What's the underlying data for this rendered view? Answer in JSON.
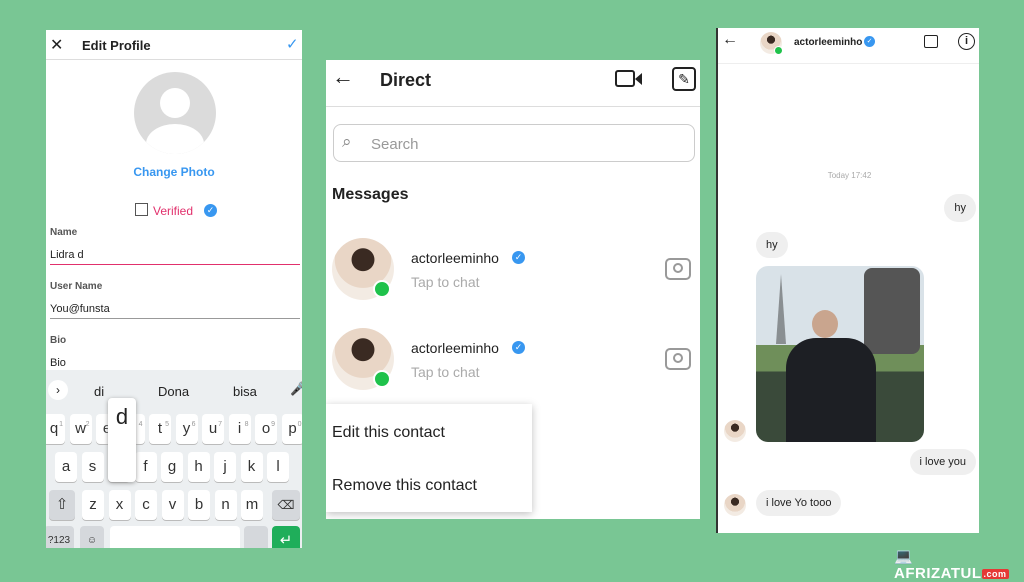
{
  "edit_profile": {
    "title": "Edit Profile",
    "change_photo": "Change Photo",
    "verified_label": "Verified",
    "fields": [
      {
        "label": "Name",
        "value": "Lidra d"
      },
      {
        "label": "User Name",
        "value": "You@funsta"
      },
      {
        "label": "Bio",
        "value": "Bio"
      }
    ],
    "keyboard": {
      "suggestions": [
        "di",
        "Dona",
        "bisa"
      ],
      "popup_key": "d",
      "row1": [
        "q",
        "w",
        "e",
        "r",
        "t",
        "y",
        "u",
        "i",
        "o",
        "p"
      ],
      "row1_hints": [
        "1",
        "2",
        "3",
        "4",
        "5",
        "6",
        "7",
        "8",
        "9",
        "0"
      ],
      "row2": [
        "a",
        "s",
        "d",
        "f",
        "g",
        "h",
        "j",
        "k",
        "l"
      ],
      "row3": [
        "z",
        "x",
        "c",
        "v",
        "b",
        "n",
        "m"
      ],
      "symbols_label": "?123"
    },
    "accent": "#e1306c"
  },
  "direct": {
    "title": "Direct",
    "search_placeholder": "Search",
    "section": "Messages",
    "threads": [
      {
        "username": "actorleeminho",
        "subtitle": "Tap to chat"
      },
      {
        "username": "actorleeminho",
        "subtitle": "Tap to chat"
      }
    ],
    "context_menu": [
      "Edit this contact",
      "Remove this contact"
    ]
  },
  "chat": {
    "username": "actorleeminho",
    "timestamp": "Today 17:42",
    "messages": [
      {
        "side": "right",
        "text": "hy"
      },
      {
        "side": "left",
        "text": "hy"
      },
      {
        "side": "left",
        "type": "photo"
      },
      {
        "side": "right",
        "text": "i love you"
      },
      {
        "side": "left",
        "text": "i love Yo tooo"
      }
    ]
  },
  "watermark": {
    "brand": "AFRIZATUL",
    "tld": ".com"
  },
  "colors": {
    "background": "#79c694",
    "verified": "#3897f0",
    "online": "#1fc24b",
    "link": "#3897f0"
  }
}
